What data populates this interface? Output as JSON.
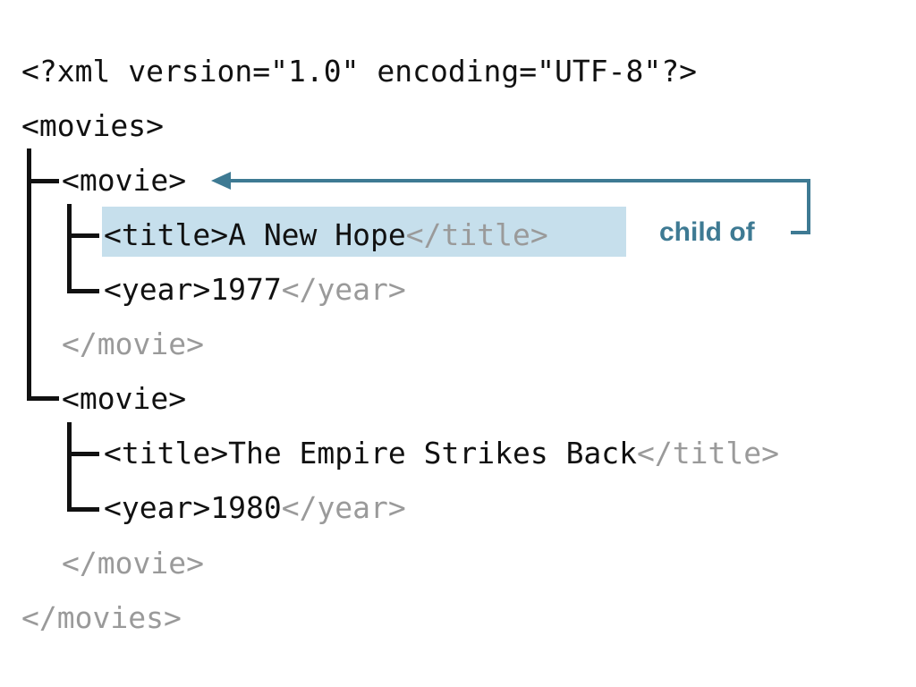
{
  "xml": {
    "declaration": "<?xml version=\"1.0\" encoding=\"UTF-8\"?>",
    "root_open": "<movies>",
    "root_close": "</movies>",
    "movies": [
      {
        "open": "<movie>",
        "title_open": "<title>",
        "title_value": "A New Hope",
        "title_close": "</title>",
        "year_open": "<year>",
        "year_value": "1977",
        "year_close": "</year>",
        "close": "</movie>"
      },
      {
        "open": "<movie>",
        "title_open": "<title>",
        "title_value": "The Empire Strikes Back",
        "title_close": "</title>",
        "year_open": "<year>",
        "year_value": "1980",
        "year_close": "</year>",
        "close": "</movie>"
      }
    ]
  },
  "annotation": {
    "label": "child of",
    "color": "#3e7a93",
    "highlight_color": "#c6dfec"
  }
}
